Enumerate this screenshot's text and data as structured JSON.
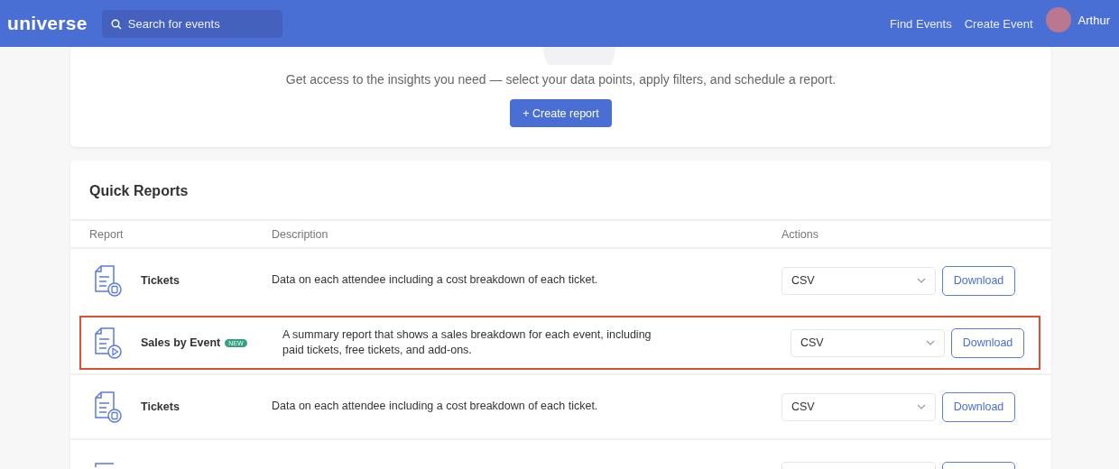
{
  "header": {
    "logo": "universe",
    "search": {
      "placeholder": "Search for events"
    },
    "links": [
      "Find Events",
      "Create Event"
    ],
    "user": "Arthur"
  },
  "intro": {
    "text": "Get access to the insights you need — select your data points, apply filters, and schedule a report.",
    "button": "+ Create report"
  },
  "quick_reports": {
    "title": "Quick Reports",
    "columns": [
      "Report",
      "Description",
      "Actions"
    ],
    "rows": [
      {
        "kind": "ticket_report",
        "name": "Tickets",
        "badge": null,
        "description": "Data on each attendee including a cost breakdown of each ticket.",
        "format": "CSV",
        "button": "Download",
        "highlighted": false
      },
      {
        "kind": "event_report",
        "name": "Sales by Event",
        "badge": "NEW",
        "description": "A summary report that shows a sales breakdown for each event, including paid tickets, free tickets, and add-ons.",
        "format": "CSV",
        "button": "Download",
        "highlighted": true
      },
      {
        "kind": "ticket_report",
        "name": "Tickets",
        "badge": null,
        "description": "Data on each attendee including a cost breakdown of each ticket.",
        "format": "CSV",
        "button": "Download",
        "highlighted": false
      },
      {
        "kind": "cut_off"
      }
    ]
  }
}
